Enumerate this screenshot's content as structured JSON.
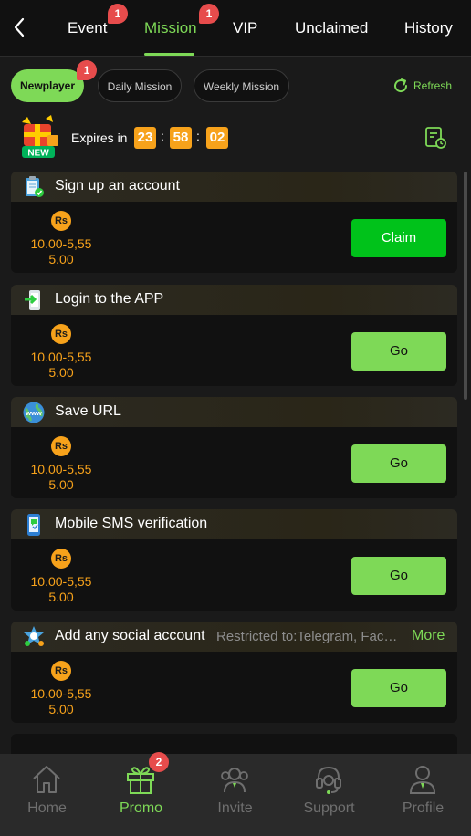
{
  "topnav": {
    "tabs": [
      {
        "label": "Event",
        "badge": "1"
      },
      {
        "label": "Mission",
        "badge": "1",
        "active": true
      },
      {
        "label": "VIP"
      },
      {
        "label": "Unclaimed"
      },
      {
        "label": "History"
      }
    ]
  },
  "subtabs": {
    "items": [
      {
        "label": "Newplayer",
        "badge": "1",
        "active": true
      },
      {
        "label": "Daily Mission"
      },
      {
        "label": "Weekly Mission"
      }
    ],
    "refresh_label": "Refresh"
  },
  "expires": {
    "new_badge": "NEW",
    "label": "Expires in",
    "hours": "23",
    "minutes": "58",
    "seconds": "02",
    "separator": ":"
  },
  "missions": [
    {
      "title": "Sign up an account",
      "currency": "Rs",
      "range": "10.00-5,55",
      "amount": "5.00",
      "button": "Claim",
      "icon": "clipboard-check-icon"
    },
    {
      "title": "Login to the APP",
      "currency": "Rs",
      "range": "10.00-5,55",
      "amount": "5.00",
      "button": "Go",
      "icon": "phone-login-icon"
    },
    {
      "title": "Save URL",
      "currency": "Rs",
      "range": "10.00-5,55",
      "amount": "5.00",
      "button": "Go",
      "icon": "www-globe-icon",
      "globe_text": "www"
    },
    {
      "title": "Mobile SMS verification",
      "currency": "Rs",
      "range": "10.00-5,55",
      "amount": "5.00",
      "button": "Go",
      "icon": "mobile-sms-icon"
    },
    {
      "title": "Add any social account",
      "restricted": "Restricted to:Telegram, Facebook",
      "more": "More",
      "currency": "Rs",
      "range": "10.00-5,55",
      "amount": "5.00",
      "button": "Go",
      "icon": "social-share-icon"
    }
  ],
  "bottomnav": {
    "items": [
      {
        "label": "Home",
        "icon": "home-icon"
      },
      {
        "label": "Promo",
        "icon": "gift-icon",
        "badge": "2",
        "active": true
      },
      {
        "label": "Invite",
        "icon": "invite-people-icon"
      },
      {
        "label": "Support",
        "icon": "headset-icon"
      },
      {
        "label": "Profile",
        "icon": "profile-icon"
      }
    ]
  },
  "colors": {
    "accent": "#7ed957",
    "claim": "#00c21a",
    "gold": "#f7a21b",
    "badge": "#e74c4c",
    "background": "#1a1a1a"
  }
}
